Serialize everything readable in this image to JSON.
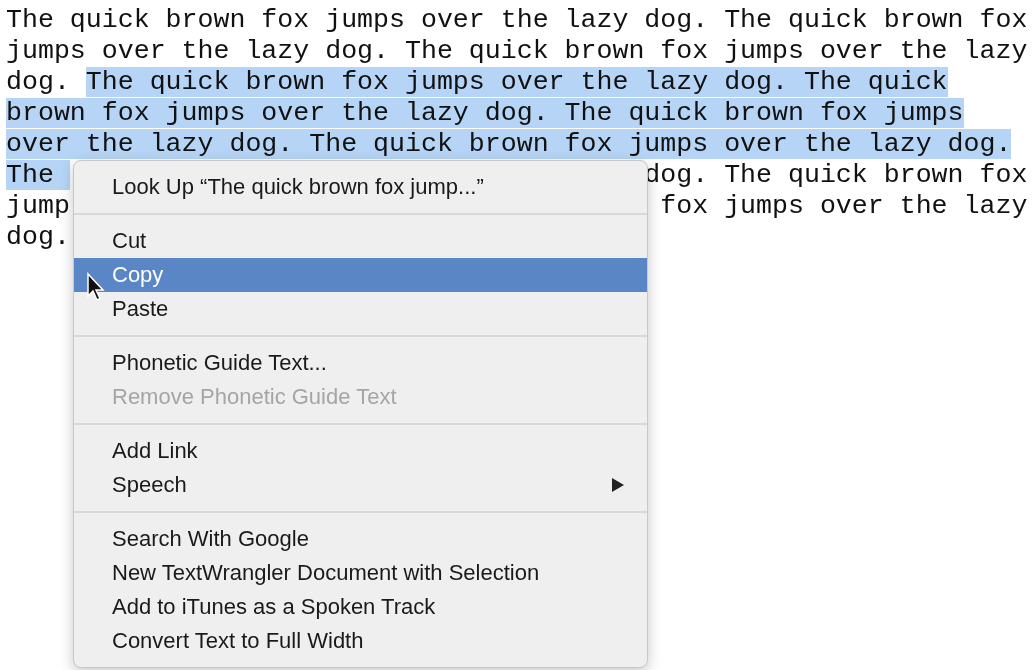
{
  "text_lines": [
    {
      "left": [
        {
          "text": "The quick brown fox jumps over the lazy dog. The quick brown fox",
          "selected": false
        }
      ]
    },
    {
      "left": [
        {
          "text": "jumps over the lazy dog. The quick brown fox jumps over the lazy",
          "selected": false
        }
      ]
    },
    {
      "left": [
        {
          "text": "dog. ",
          "selected": false
        },
        {
          "text": "The quick brown fox jumps over the lazy dog. The quick",
          "selected": true
        }
      ]
    },
    {
      "left": [
        {
          "text": "brown fox jumps over the lazy dog. The quick brown fox jumps",
          "selected": true
        }
      ]
    },
    {
      "left": [
        {
          "text": "over the lazy dog. The quick brown fox jumps over the lazy dog.",
          "selected": true
        }
      ]
    },
    {
      "left": [
        {
          "text": "The ",
          "selected": true
        }
      ],
      "right": [
        {
          "text": "dog. The quick brown fox",
          "selected": false
        }
      ]
    },
    {
      "left": [
        {
          "text": "jump",
          "selected": false
        }
      ],
      "right": [
        {
          "text": "fox jumps over the lazy",
          "selected": false
        }
      ]
    },
    {
      "left": [
        {
          "text": "dog.",
          "selected": false
        }
      ]
    }
  ],
  "context_menu": {
    "sections": [
      [
        {
          "label": "Look Up “The quick brown fox jump...”",
          "selected": false,
          "disabled": false,
          "submenu": false
        }
      ],
      [
        {
          "label": "Cut",
          "selected": false,
          "disabled": false,
          "submenu": false
        },
        {
          "label": "Copy",
          "selected": true,
          "disabled": false,
          "submenu": false
        },
        {
          "label": "Paste",
          "selected": false,
          "disabled": false,
          "submenu": false
        }
      ],
      [
        {
          "label": "Phonetic Guide Text...",
          "selected": false,
          "disabled": false,
          "submenu": false
        },
        {
          "label": "Remove Phonetic Guide Text",
          "selected": false,
          "disabled": true,
          "submenu": false
        }
      ],
      [
        {
          "label": "Add Link",
          "selected": false,
          "disabled": false,
          "submenu": false
        },
        {
          "label": "Speech",
          "selected": false,
          "disabled": false,
          "submenu": true
        }
      ],
      [
        {
          "label": "Search With Google",
          "selected": false,
          "disabled": false,
          "submenu": false
        },
        {
          "label": "New TextWrangler Document with Selection",
          "selected": false,
          "disabled": false,
          "submenu": false
        },
        {
          "label": "Add to iTunes as a Spoken Track",
          "selected": false,
          "disabled": false,
          "submenu": false
        },
        {
          "label": "Convert Text to Full Width",
          "selected": false,
          "disabled": false,
          "submenu": false
        }
      ]
    ]
  }
}
